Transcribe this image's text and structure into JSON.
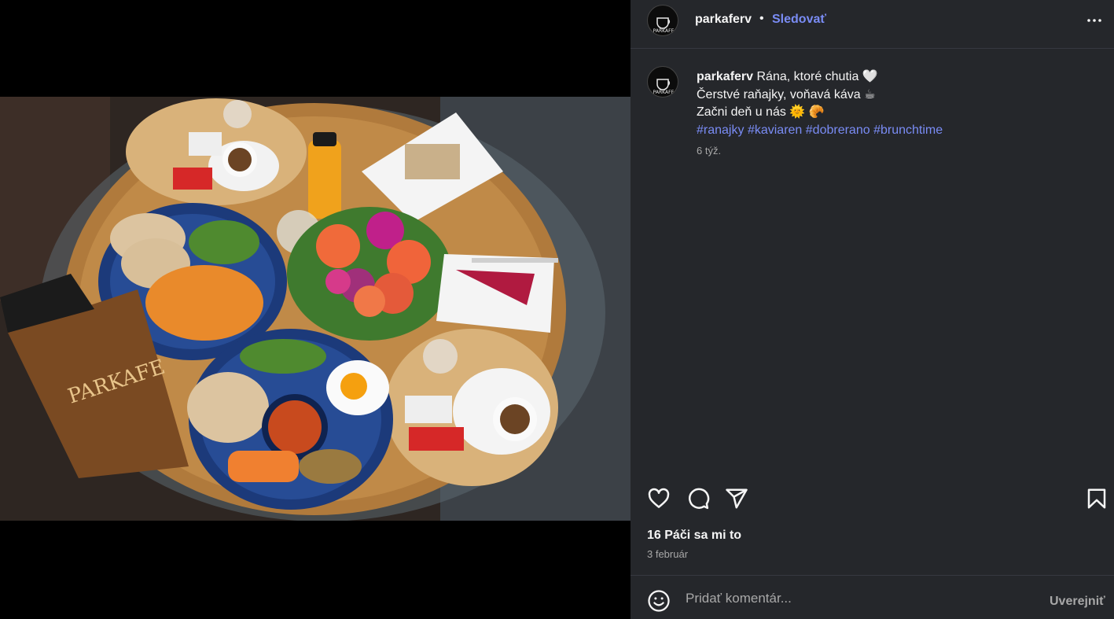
{
  "post": {
    "username": "parkaferv",
    "separator": "•",
    "follow_label": "Sledovať",
    "more_icon": "more-horizontal-icon",
    "caption": {
      "username": "parkaferv",
      "line1": "Rána, ktoré chutia 🤍",
      "line2": "Čerstvé raňajky, voňavá káva ☕",
      "line3": "Začni deň u nás 🌞 🥐",
      "hashtags": [
        "#ranajky",
        "#kaviaren",
        "#dobrerano",
        "#brunchtime"
      ],
      "time": "6 týž."
    },
    "actions": {
      "like_icon": "heart-icon",
      "comment_icon": "comment-icon",
      "share_icon": "share-icon",
      "save_icon": "bookmark-icon"
    },
    "likes": "16 Páči sa mi to",
    "date": "3 február"
  },
  "comment": {
    "emoji_icon": "emoji-icon",
    "placeholder": "Pridať komentár...",
    "post_label": "Uverejniť"
  },
  "media": {
    "menu_text": "PARKAFE",
    "description_icon": "photo-image"
  },
  "colors": {
    "panel_bg": "#25272b",
    "link": "#7a8cf5",
    "muted": "#a8a8a8",
    "text": "#f5f5f5"
  }
}
